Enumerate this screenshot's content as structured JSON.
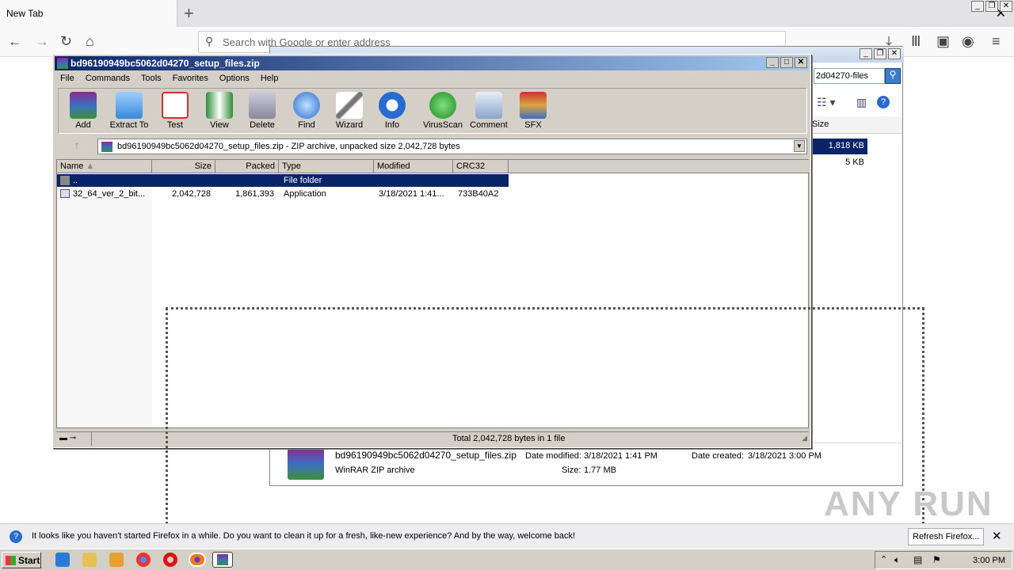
{
  "firefox": {
    "tab_title": "New Tab",
    "url_placeholder": "Search with Google or enter address",
    "notification": "It looks like you haven't started Firefox in a while. Do you want to clean it up for a fresh, like-new experience? And by the way, welcome back!",
    "refresh_button": "Refresh Firefox..."
  },
  "explorer": {
    "search_value": "2d04270-files",
    "col_size": "Size",
    "sel_size": "1,818 KB",
    "size2": "5 KB",
    "details": {
      "name": "bd96190949bc5062d04270_setup_files.zip",
      "type": "WinRAR ZIP archive",
      "date_modified_label": "Date modified:",
      "date_modified": "3/18/2021 1:41 PM",
      "date_created_label": "Date created:",
      "date_created": "3/18/2021 3:00 PM",
      "size_label": "Size:",
      "size": "1.77 MB"
    }
  },
  "winrar": {
    "title": "bd96190949bc5062d04270_setup_files.zip",
    "menu": [
      "File",
      "Commands",
      "Tools",
      "Favorites",
      "Options",
      "Help"
    ],
    "toolbar": [
      "Add",
      "Extract To",
      "Test",
      "View",
      "Delete",
      "Find",
      "Wizard",
      "Info",
      "VirusScan",
      "Comment",
      "SFX"
    ],
    "path": "bd96190949bc5062d04270_setup_files.zip - ZIP archive, unpacked size 2,042,728 bytes",
    "columns": [
      "Name",
      "Size",
      "Packed",
      "Type",
      "Modified",
      "CRC32"
    ],
    "rows": [
      {
        "name": "..",
        "size": "",
        "packed": "",
        "type": "File folder",
        "modified": "",
        "crc": ""
      },
      {
        "name": "32_64_ver_2_bit...",
        "size": "2,042,728",
        "packed": "1,861,393",
        "type": "Application",
        "modified": "3/18/2021 1:41...",
        "crc": "733B40A2"
      }
    ],
    "status": "Total 2,042,728 bytes in 1 file"
  },
  "taskbar": {
    "start": "Start",
    "clock": "3:00 PM"
  },
  "watermark": "ANY RUN"
}
